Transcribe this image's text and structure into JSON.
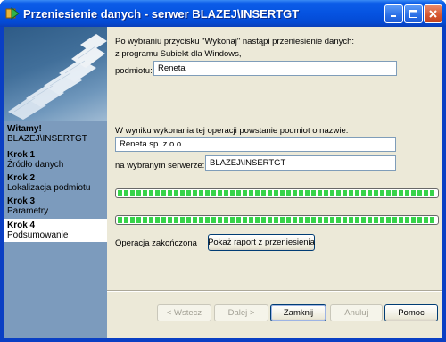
{
  "window": {
    "title": "Przeniesienie danych - serwer BLAZEJ\\INSERTGT"
  },
  "titlebar_buttons": [
    "minimize-icon",
    "maximize-icon",
    "close-icon"
  ],
  "sidebar": {
    "steps": [
      {
        "title": "Witamy!",
        "subtitle": "BLAZEJ\\INSERTGT",
        "active": false
      },
      {
        "title": "Krok 1",
        "subtitle": "Źródło danych",
        "active": false
      },
      {
        "title": "Krok 2",
        "subtitle": "Lokalizacja podmiotu",
        "active": false
      },
      {
        "title": "Krok 3",
        "subtitle": "Parametry",
        "active": false
      },
      {
        "title": "Krok 4",
        "subtitle": "Podsumowanie",
        "active": true
      }
    ]
  },
  "main": {
    "intro_line1": "Po wybraniu przycisku \"Wykonaj\" nastąpi przeniesienie danych:",
    "intro_line2": "z programu Subiekt dla Windows,",
    "subject_label": "podmiotu:",
    "subject_value": "Reneta",
    "result_line": "W wyniku wykonania tej operacji powstanie podmiot o nazwie:",
    "new_name_value": "Reneta sp. z o.o.",
    "server_label": "na wybranym serwerze:",
    "server_value": "BLAZEJ\\INSERTGT",
    "progress1": 1.0,
    "progress2": 1.0,
    "status_text": "Operacja zakończona",
    "report_button": "Pokaż raport z przeniesienia"
  },
  "buttons": {
    "back": "< Wstecz",
    "next": "Dalej >",
    "close": "Zamknij",
    "cancel": "Anuluj",
    "help": "Pomoc"
  },
  "colors": {
    "titlebar": "#0553e1",
    "sidebar_steps": "#7c9bbd",
    "progress_fill": "#37d34a",
    "dialog_bg": "#ece9d8"
  }
}
